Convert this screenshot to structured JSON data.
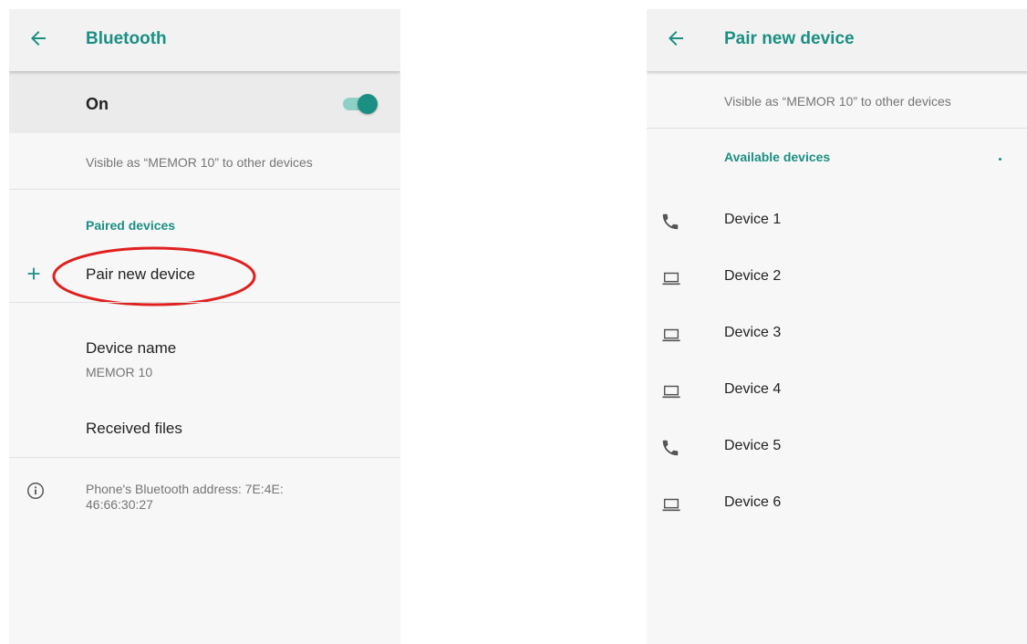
{
  "left": {
    "title": "Bluetooth",
    "master_toggle": {
      "label": "On",
      "on": true
    },
    "visible_as": "Visible as “MEMOR 10” to other devices",
    "section_header": "Paired devices",
    "pair_new": "Pair new device",
    "device_name": {
      "title": "Device name",
      "value": "MEMOR 10"
    },
    "received_files": "Received files",
    "address_info": {
      "line1": "Phone's Bluetooth address: 7E:4E:",
      "line2": "46:66:30:27"
    }
  },
  "right": {
    "title": "Pair new device",
    "visible_as": "Visible as “MEMOR 10” to other devices",
    "section_header": "Available devices",
    "devices": [
      {
        "name": "Device 1",
        "icon": "phone-icon"
      },
      {
        "name": "Device 2",
        "icon": "laptop-icon"
      },
      {
        "name": "Device 3",
        "icon": "laptop-icon"
      },
      {
        "name": "Device 4",
        "icon": "laptop-icon"
      },
      {
        "name": "Device 5",
        "icon": "phone-icon"
      },
      {
        "name": "Device 6",
        "icon": "laptop-icon"
      }
    ]
  },
  "colors": {
    "accent": "#1b8f83",
    "annotation": "#e02020"
  }
}
